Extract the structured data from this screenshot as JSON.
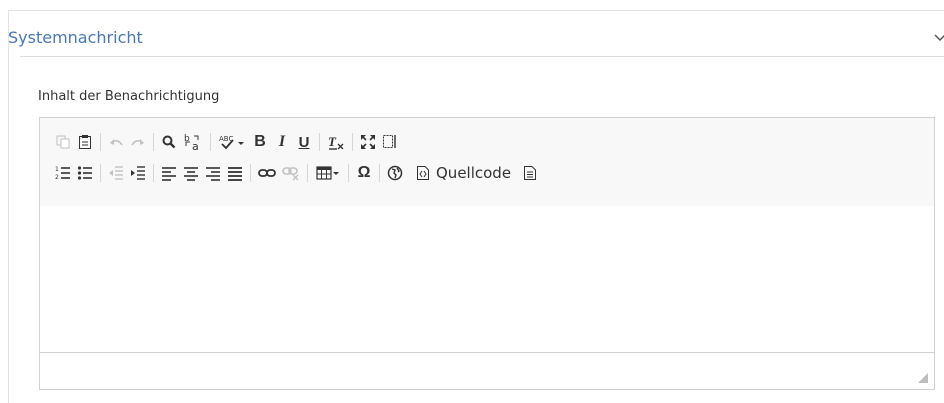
{
  "panel": {
    "title": "Systemnachricht"
  },
  "field": {
    "label": "Inhalt der Benachrichtigung"
  },
  "editor": {
    "toolbar": {
      "source_label": "Quellcode",
      "italic_glyph": "I",
      "bold_glyph": "B",
      "underline_glyph": "U",
      "omega_glyph": "Ω"
    },
    "content": ""
  },
  "colors": {
    "title": "#4a78b3",
    "border": "#d1d1d1",
    "toolbar_bg": "#f8f8f8"
  }
}
